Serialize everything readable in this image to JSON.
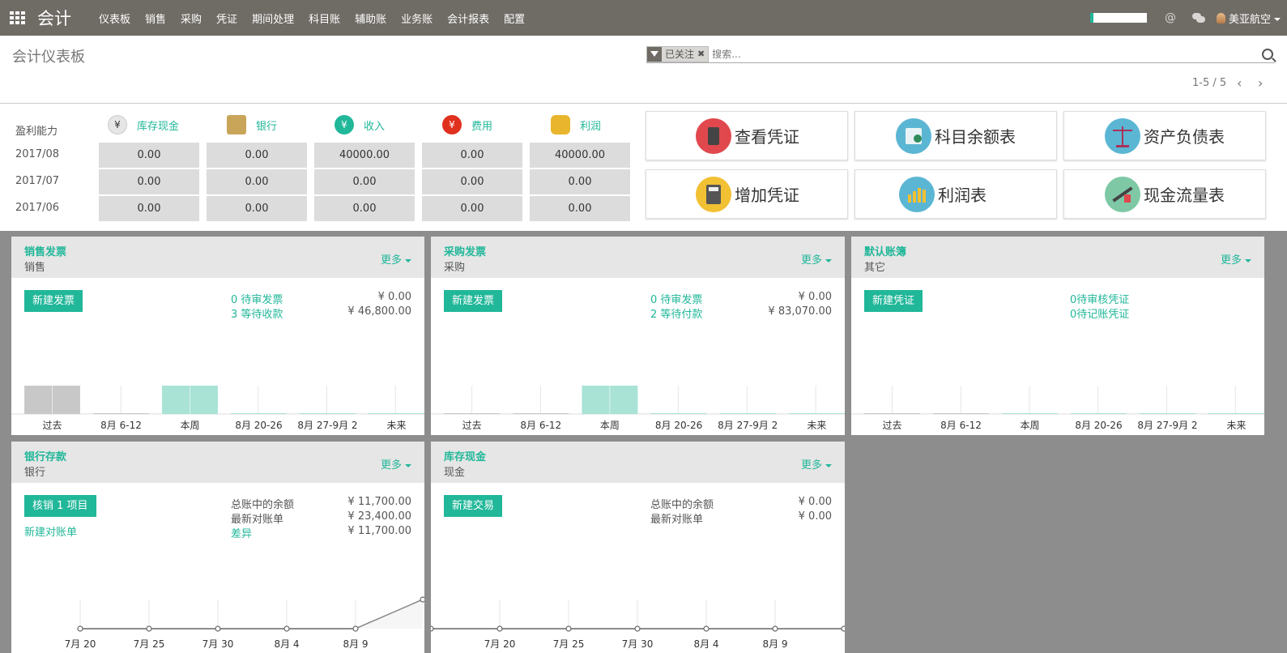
{
  "navbar": {
    "brand": "会计",
    "menu": [
      "仪表板",
      "销售",
      "采购",
      "凭证",
      "期间处理",
      "科目账",
      "辅助账",
      "业务账",
      "会计报表",
      "配置"
    ],
    "at": "@",
    "user": "美亚航空"
  },
  "control": {
    "title": "会计仪表板",
    "facet": "已关注",
    "facet_remove": "✖",
    "search_placeholder": "搜索...",
    "pager": "1-5 / 5",
    "prev": "‹",
    "next": "›"
  },
  "summary": {
    "header": "盈利能力",
    "columns": [
      {
        "label": "库存现金",
        "icon": "yen-icon",
        "glyph": "¥",
        "color": "#e6e6e6"
      },
      {
        "label": "银行",
        "icon": "bank-icon",
        "glyph": "🏦",
        "color": "#c9a55a"
      },
      {
        "label": "收入",
        "icon": "income-icon",
        "glyph": "¥",
        "color": "#21b799"
      },
      {
        "label": "费用",
        "icon": "expense-icon",
        "glyph": "¥",
        "color": "#e0301e"
      },
      {
        "label": "利润",
        "icon": "coins-icon",
        "glyph": "●",
        "color": "#e8b52c"
      }
    ],
    "rows": [
      {
        "period": "2017/08",
        "values": [
          "0.00",
          "0.00",
          "40000.00",
          "0.00",
          "40000.00"
        ]
      },
      {
        "period": "2017/07",
        "values": [
          "0.00",
          "0.00",
          "0.00",
          "0.00",
          "0.00"
        ]
      },
      {
        "period": "2017/06",
        "values": [
          "0.00",
          "0.00",
          "0.00",
          "0.00",
          "0.00"
        ]
      }
    ]
  },
  "quick_buttons": [
    {
      "label": "查看凭证",
      "icon": "view-voucher-icon",
      "color": "#e0484d"
    },
    {
      "label": "科目余额表",
      "icon": "account-balance-icon",
      "color": "#5bb6d4"
    },
    {
      "label": "资产负债表",
      "icon": "balance-sheet-icon",
      "color": "#5bb6d4"
    },
    {
      "label": "增加凭证",
      "icon": "add-voucher-icon",
      "color": "#f2c033"
    },
    {
      "label": "利润表",
      "icon": "profit-report-icon",
      "color": "#5bb6d4"
    },
    {
      "label": "现金流量表",
      "icon": "cashflow-icon",
      "color": "#7ec8a6"
    }
  ],
  "cards": {
    "sales": {
      "title": "销售发票",
      "subtitle": "销售",
      "more": "更多",
      "button": "新建发票",
      "links": [
        "0 待审发票",
        "3 等待收款"
      ],
      "values": [
        "¥ 0.00",
        "¥ 46,800.00"
      ]
    },
    "purchase": {
      "title": "采购发票",
      "subtitle": "采购",
      "more": "更多",
      "button": "新建发票",
      "links": [
        "0 待审发票",
        "2 等待付款"
      ],
      "values": [
        "¥ 0.00",
        "¥ 83,070.00"
      ]
    },
    "misc": {
      "title": "默认账簿",
      "subtitle": "其它",
      "more": "更多",
      "button": "新建凭证",
      "links": [
        "0待审核凭证",
        "0待记账凭证"
      ]
    },
    "bank": {
      "title": "银行存款",
      "subtitle": "银行",
      "more": "更多",
      "button": "核销 1 项目",
      "link": "新建对账单",
      "labels": [
        "总账中的余额",
        "最新对账单",
        "差异"
      ],
      "values": [
        "¥ 11,700.00",
        "¥ 23,400.00",
        "¥ 11,700.00"
      ]
    },
    "cash": {
      "title": "库存现金",
      "subtitle": "现金",
      "more": "更多",
      "button": "新建交易",
      "labels": [
        "总账中的余额",
        "最新对账单"
      ],
      "values": [
        "¥ 0.00",
        "¥ 0.00"
      ]
    }
  },
  "chart_data": [
    {
      "type": "bar",
      "categories": [
        "过去",
        "8月 6-12",
        "本周",
        "8月 20-26",
        "8月 27-9月 2",
        "未来"
      ],
      "values": [
        1,
        0.02,
        1,
        0.02,
        0.02,
        0.02
      ],
      "colors": [
        "#c8c8c8",
        "#c8c8c8",
        "#a8e3d6",
        "#a8e3d6",
        "#a8e3d6",
        "#a8e3d6"
      ]
    },
    {
      "type": "bar",
      "categories": [
        "过去",
        "8月 6-12",
        "本周",
        "8月 20-26",
        "8月 27-9月 2",
        "未来"
      ],
      "values": [
        0.02,
        0.02,
        1,
        0.02,
        0.02,
        0.02
      ],
      "colors": [
        "#c8c8c8",
        "#c8c8c8",
        "#a8e3d6",
        "#a8e3d6",
        "#a8e3d6",
        "#a8e3d6"
      ]
    },
    {
      "type": "bar",
      "categories": [
        "过去",
        "8月 6-12",
        "本周",
        "8月 20-26",
        "8月 27-9月 2",
        "未来"
      ],
      "values": [
        0.02,
        0.02,
        0.02,
        0.02,
        0.02,
        0.02
      ],
      "colors": [
        "#c8c8c8",
        "#c8c8c8",
        "#a8e3d6",
        "#a8e3d6",
        "#a8e3d6",
        "#a8e3d6"
      ]
    },
    {
      "type": "line",
      "categories": [
        "7月 20",
        "7月 25",
        "7月 30",
        "8月 4",
        "8月 9"
      ],
      "values": [
        0,
        0,
        0,
        0,
        0,
        1
      ]
    },
    {
      "type": "line",
      "categories": [
        "7月 20",
        "7月 25",
        "7月 30",
        "8月 4",
        "8月 9"
      ],
      "values": [
        0,
        0,
        0,
        0,
        0,
        0,
        0
      ]
    }
  ]
}
